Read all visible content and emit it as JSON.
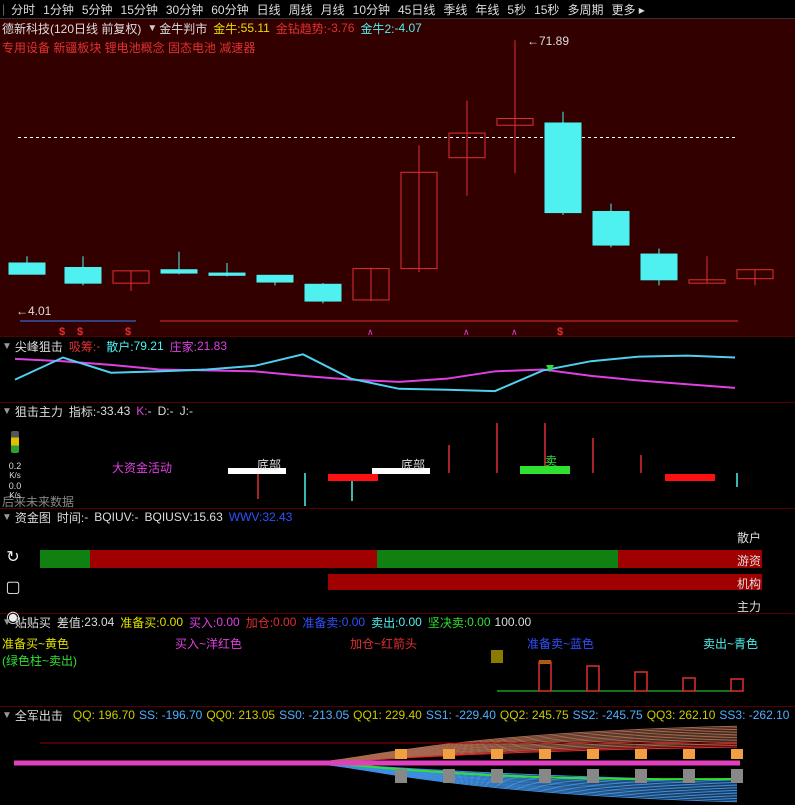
{
  "toolbar": {
    "periods": [
      "分时",
      "1分钟",
      "5分钟",
      "15分钟",
      "30分钟",
      "60分钟",
      "日线",
      "周线",
      "月线",
      "10分钟",
      "45日线",
      "季线",
      "年线",
      "5秒",
      "15秒",
      "多周期",
      "更多"
    ]
  },
  "main": {
    "stock": "德新科技",
    "mode": "(120日线 前复权)",
    "indicator": "金牛判市",
    "jn_label": "金牛:",
    "jn_value": "55.11",
    "trend_label": "金钻趋势:",
    "trend_value": "-3.76",
    "jn2_label": "金牛2:",
    "jn2_value": "-4.07",
    "concepts": "专用设备 新疆板块 锂电池概念 固态电池 减速器",
    "high_mark": "71.89",
    "low_mark": "4.01",
    "colors": {
      "bg": "#330000",
      "up": "#e03030",
      "down": "#4ff0f0"
    }
  },
  "chart_data": {
    "type": "candlestick",
    "candles": [
      {
        "open": 52,
        "close": 51,
        "high": 52.6,
        "low": 51
      },
      {
        "open": 51.6,
        "close": 50.2,
        "high": 52.6,
        "low": 50
      },
      {
        "open": 50.2,
        "close": 51.3,
        "high": 51.3,
        "low": 49.5
      },
      {
        "open": 51.4,
        "close": 51.1,
        "high": 53,
        "low": 51
      },
      {
        "open": 51.1,
        "close": 50.9,
        "high": 52,
        "low": 50.8
      },
      {
        "open": 50.9,
        "close": 50.3,
        "high": 50.9,
        "low": 50
      },
      {
        "open": 50.1,
        "close": 48.6,
        "high": 50.2,
        "low": 48.4
      },
      {
        "open": 48.7,
        "close": 51.5,
        "high": 51.6,
        "low": 48.6
      },
      {
        "open": 51.5,
        "close": 60.1,
        "high": 62.5,
        "low": 51.2
      },
      {
        "open": 61.4,
        "close": 63.6,
        "high": 66.5,
        "low": 58
      },
      {
        "open": 64.3,
        "close": 64.9,
        "high": 71.89,
        "low": 60
      },
      {
        "open": 64.5,
        "close": 56.5,
        "high": 65.5,
        "low": 56.3
      },
      {
        "open": 56.6,
        "close": 53.6,
        "high": 57.3,
        "low": 53.4
      },
      {
        "open": 52.8,
        "close": 50.5,
        "high": 53.3,
        "low": 50
      },
      {
        "open": 50.2,
        "close": 50.5,
        "high": 52.6,
        "low": 50.2
      },
      {
        "open": 50.6,
        "close": 51.4,
        "high": 51.4,
        "low": 50
      }
    ],
    "dashed_level": 63.2,
    "y_range": [
      47,
      72
    ]
  },
  "p2": {
    "title": "尖峰狙击",
    "xichou_label": "吸筹:",
    "xichou_value": "-",
    "sanhu_label": "散户:",
    "sanhu_value": "79.21",
    "zhuangjia_label": "庄家:",
    "zhuangjia_value": "21.83",
    "sanhu_series": [
      40,
      88,
      55,
      58,
      62,
      70,
      95,
      42,
      20,
      18,
      15,
      60,
      80,
      90,
      92,
      88
    ],
    "zhuangjia_series": [
      85,
      80,
      72,
      62,
      60,
      58,
      48,
      40,
      35,
      42,
      58,
      62,
      48,
      38,
      30,
      22
    ]
  },
  "p3": {
    "title": "狙击主力",
    "zhibiao_label": "指标:",
    "zhibiao_value": "-33.43",
    "k_label": "K:",
    "k_value": "-",
    "d_label": "D:",
    "d_value": "-",
    "j_label": "J:",
    "j_value": "-",
    "activity_label": "大资金活动",
    "bottom_label1": "底部",
    "bottom_label2": "底部",
    "mai_label": "卖",
    "future_label": "后来未来数据",
    "side_value": "0.2",
    "side_k": "K/s",
    "side_value2": "0.0",
    "side_k2": "K/s"
  },
  "p4": {
    "title": "资金图",
    "time_label": "时间:",
    "time_value": "-",
    "bqiuv_label": "BQIUV:",
    "bqiuv_value": "-",
    "bqiusv_label": "BQIUSV:",
    "bqiusv_value": "15.63",
    "wwv_label": "WWV:",
    "wwv_value": "32.43",
    "rows": [
      "散户",
      "游资",
      "机构",
      "主力"
    ]
  },
  "p5": {
    "title": "贴贴买",
    "chazhi_label": "差值:",
    "chazhi_value": "23.04",
    "zbm_label": "准备买:",
    "zbm_value": "0.00",
    "mr_label": "买入:",
    "mr_value": "0.00",
    "jc_label": "加仓:",
    "jc_value": "0.00",
    "zbmc_label": "准备卖:",
    "zbmc_value": "0.00",
    "mc_label": "卖出:",
    "mc_value": "0.00",
    "jjm_label": "坚决卖:",
    "jjm_value": "0.00",
    "last_value": "100.00",
    "legend_ready_buy": "准备买~黄色",
    "legend_green": "(绿色柱~卖出)",
    "legend_buy": "买入~洋红色",
    "legend_add": "加仓~红箭头",
    "legend_ready_sell": "准备卖~蓝色",
    "legend_sell": "卖出~青色"
  },
  "p6": {
    "title": "全军出击",
    "values": [
      {
        "label": "QQ:",
        "value": "196.70",
        "color": "#cccc00"
      },
      {
        "label": "SS:",
        "value": "-196.70",
        "color": "#4fb0ff"
      },
      {
        "label": "QQ0:",
        "value": "213.05",
        "color": "#cccc00"
      },
      {
        "label": "SS0:",
        "value": "-213.05",
        "color": "#4fb0ff"
      },
      {
        "label": "QQ1:",
        "value": "229.40",
        "color": "#cccc00"
      },
      {
        "label": "SS1:",
        "value": "-229.40",
        "color": "#4fb0ff"
      },
      {
        "label": "QQ2:",
        "value": "245.75",
        "color": "#cccc00"
      },
      {
        "label": "SS2:",
        "value": "-245.75",
        "color": "#4fb0ff"
      },
      {
        "label": "QQ3:",
        "value": "262.10",
        "color": "#cccc00"
      },
      {
        "label": "SS3:",
        "value": "-262.10",
        "color": "#4fb0ff"
      }
    ]
  }
}
